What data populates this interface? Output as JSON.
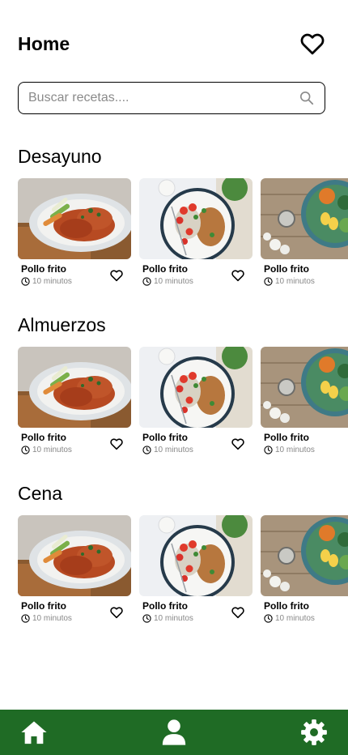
{
  "header": {
    "title": "Home",
    "favorites_icon": "heart-outline-icon"
  },
  "search": {
    "placeholder": "Buscar recetas....",
    "icon": "search-icon"
  },
  "sections": [
    {
      "title": "Desayuno",
      "cards": [
        {
          "name": "Pollo frito",
          "time": "10 minutos",
          "image": "fried-chicken-plate"
        },
        {
          "name": "Pollo frito",
          "time": "10 minutos",
          "image": "grilled-chicken-salad-plate"
        },
        {
          "name": "Pollo frito",
          "time": "10 minutos",
          "image": "vegetable-bowl-on-wood"
        }
      ]
    },
    {
      "title": "Almuerzos",
      "cards": [
        {
          "name": "Pollo frito",
          "time": "10 minutos",
          "image": "fried-chicken-plate"
        },
        {
          "name": "Pollo frito",
          "time": "10 minutos",
          "image": "grilled-chicken-salad-plate"
        },
        {
          "name": "Pollo frito",
          "time": "10 minutos",
          "image": "vegetable-bowl-on-wood"
        }
      ]
    },
    {
      "title": "Cena",
      "cards": [
        {
          "name": "Pollo frito",
          "time": "10 minutos",
          "image": "fried-chicken-plate"
        },
        {
          "name": "Pollo frito",
          "time": "10 minutos",
          "image": "grilled-chicken-salad-plate"
        },
        {
          "name": "Pollo frito",
          "time": "10 minutos",
          "image": "vegetable-bowl-on-wood"
        }
      ]
    }
  ],
  "bottom_nav": {
    "background": "#1f6b25",
    "items": [
      {
        "icon": "home-icon"
      },
      {
        "icon": "user-icon"
      },
      {
        "icon": "gear-icon"
      }
    ]
  }
}
